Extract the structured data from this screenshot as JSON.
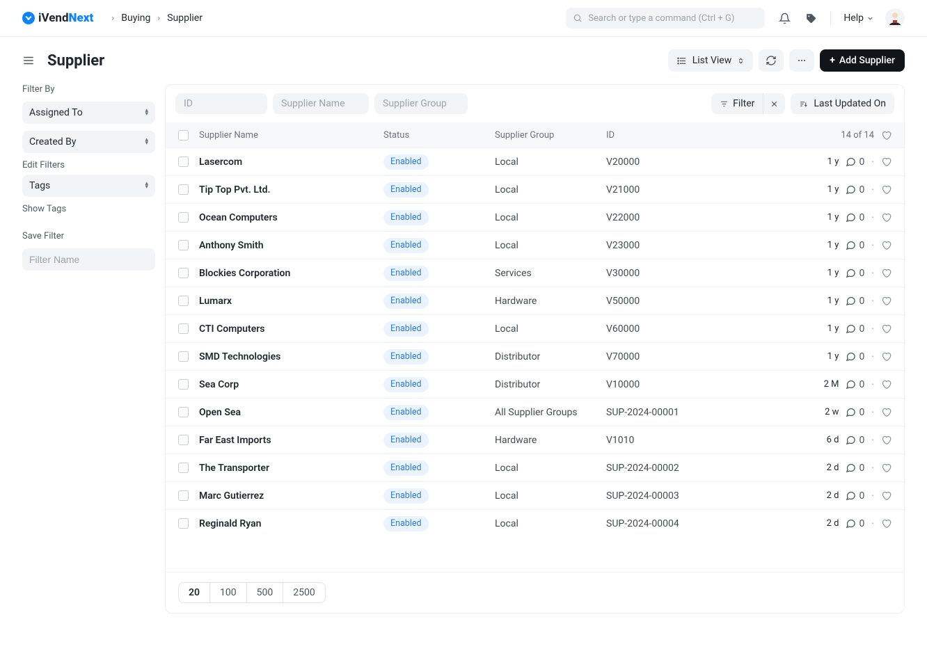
{
  "brand": {
    "prefix": "iVend",
    "suffix": "Next"
  },
  "breadcrumbs": [
    "Buying",
    "Supplier"
  ],
  "search_placeholder": "Search or type a command (Ctrl + G)",
  "help_label": "Help",
  "page_title": "Supplier",
  "view_switcher": "List View",
  "primary_action": "Add Supplier",
  "sidebar": {
    "filter_by_heading": "Filter By",
    "assigned_to": "Assigned To",
    "created_by": "Created By",
    "edit_filters": "Edit Filters",
    "tags": "Tags",
    "show_tags": "Show Tags",
    "save_filter": "Save Filter",
    "filter_name_placeholder": "Filter Name"
  },
  "toolbar": {
    "id_ph": "ID",
    "name_ph": "Supplier Name",
    "group_ph": "Supplier Group",
    "filter_label": "Filter",
    "sort_label": "Last Updated On"
  },
  "columns": {
    "name": "Supplier Name",
    "status": "Status",
    "group": "Supplier Group",
    "id": "ID",
    "count": "14 of 14"
  },
  "status_label": "Enabled",
  "rows": [
    {
      "name": "Lasercom",
      "group": "Local",
      "id": "V20000",
      "age": "1 y",
      "comments": 0
    },
    {
      "name": "Tip Top Pvt. Ltd.",
      "group": "Local",
      "id": "V21000",
      "age": "1 y",
      "comments": 0
    },
    {
      "name": "Ocean Computers",
      "group": "Local",
      "id": "V22000",
      "age": "1 y",
      "comments": 0
    },
    {
      "name": "Anthony Smith",
      "group": "Local",
      "id": "V23000",
      "age": "1 y",
      "comments": 0
    },
    {
      "name": "Blockies Corporation",
      "group": "Services",
      "id": "V30000",
      "age": "1 y",
      "comments": 0
    },
    {
      "name": "Lumarx",
      "group": "Hardware",
      "id": "V50000",
      "age": "1 y",
      "comments": 0
    },
    {
      "name": "CTI Computers",
      "group": "Local",
      "id": "V60000",
      "age": "1 y",
      "comments": 0
    },
    {
      "name": "SMD Technologies",
      "group": "Distributor",
      "id": "V70000",
      "age": "1 y",
      "comments": 0
    },
    {
      "name": "Sea Corp",
      "group": "Distributor",
      "id": "V10000",
      "age": "2 M",
      "comments": 0
    },
    {
      "name": "Open Sea",
      "group": "All Supplier Groups",
      "id": "SUP-2024-00001",
      "age": "2 w",
      "comments": 0
    },
    {
      "name": "Far East Imports",
      "group": "Hardware",
      "id": "V1010",
      "age": "6 d",
      "comments": 0
    },
    {
      "name": "The Transporter",
      "group": "Local",
      "id": "SUP-2024-00002",
      "age": "2 d",
      "comments": 0
    },
    {
      "name": "Marc Gutierrez",
      "group": "Local",
      "id": "SUP-2024-00003",
      "age": "2 d",
      "comments": 0
    },
    {
      "name": "Reginald Ryan",
      "group": "Local",
      "id": "SUP-2024-00004",
      "age": "2 d",
      "comments": 0
    }
  ],
  "page_sizes": [
    "20",
    "100",
    "500",
    "2500"
  ],
  "active_page_size": "20"
}
